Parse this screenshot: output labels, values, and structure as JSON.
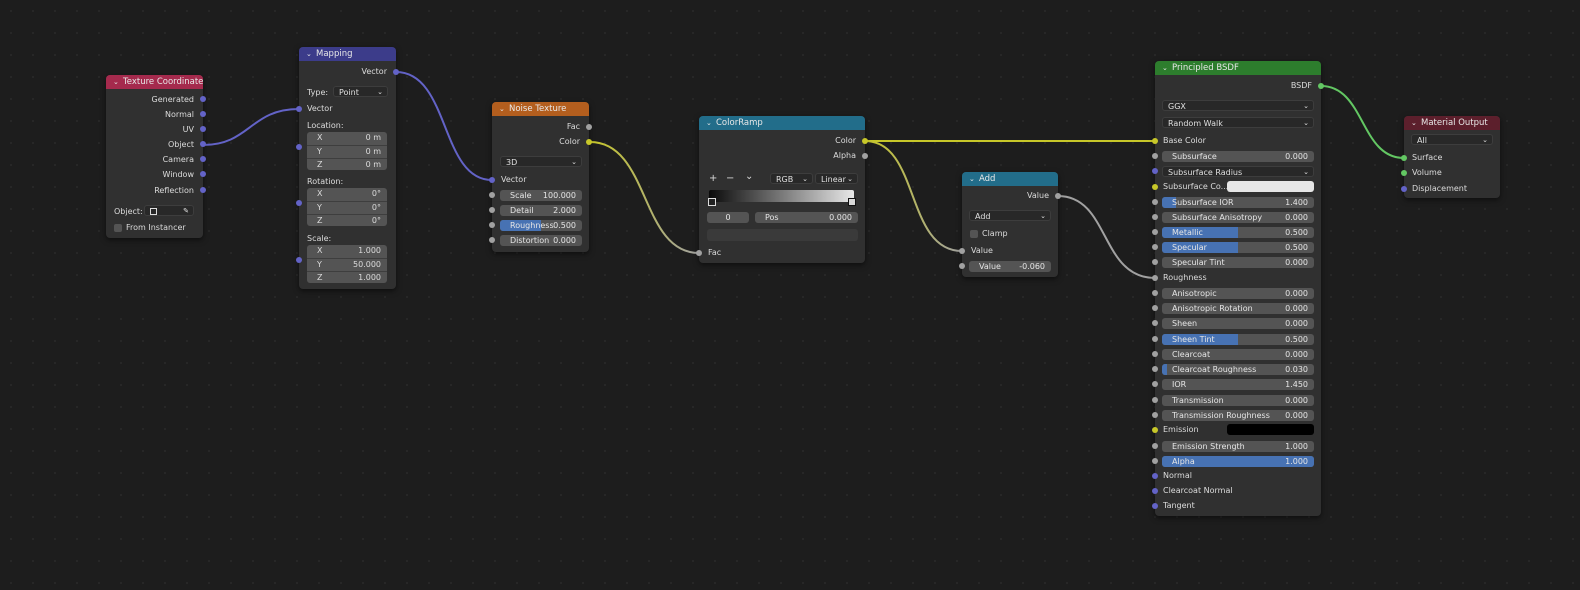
{
  "colors": {
    "vector_socket": "#6363c7",
    "color_socket": "#c7c729",
    "float_socket": "#a1a1a1",
    "shader_socket": "#63c763",
    "texture_coordinate_header": "#a52a4d",
    "mapping_header": "#3c3c8a",
    "noise_texture_header": "#b35e1e",
    "colorramp_header": "#226d8a",
    "add_header": "#226d8a",
    "principled_header": "#2d7d2d",
    "material_output_header": "#5c1f2c",
    "slider_fill": "#4772b3"
  },
  "nodes": {
    "texture_coordinate": {
      "title": "Texture Coordinate",
      "outputs": [
        "Generated",
        "Normal",
        "UV",
        "Object",
        "Camera",
        "Window",
        "Reflection"
      ],
      "object_label": "Object:",
      "from_instancer": "From Instancer",
      "icons": [
        "object-icon",
        "eyedropper-icon"
      ]
    },
    "mapping": {
      "title": "Mapping",
      "output": "Vector",
      "type_label": "Type:",
      "type_value": "Point",
      "input_vector": "Vector",
      "location_label": "Location:",
      "location": [
        {
          "axis": "X",
          "value": "0 m"
        },
        {
          "axis": "Y",
          "value": "0 m"
        },
        {
          "axis": "Z",
          "value": "0 m"
        }
      ],
      "rotation_label": "Rotation:",
      "rotation": [
        {
          "axis": "X",
          "value": "0°"
        },
        {
          "axis": "Y",
          "value": "0°"
        },
        {
          "axis": "Z",
          "value": "0°"
        }
      ],
      "scale_label": "Scale:",
      "scale": [
        {
          "axis": "X",
          "value": "1.000"
        },
        {
          "axis": "Y",
          "value": "50.000"
        },
        {
          "axis": "Z",
          "value": "1.000"
        }
      ]
    },
    "noise_texture": {
      "title": "Noise Texture",
      "outputs": [
        "Fac",
        "Color"
      ],
      "dimensions": "3D",
      "input_vector": "Vector",
      "fields": [
        {
          "label": "Scale",
          "value": "100.000",
          "fill": 0
        },
        {
          "label": "Detail",
          "value": "2.000",
          "fill": 0
        },
        {
          "label": "Roughness",
          "value": "0.500",
          "fill": 0.5
        },
        {
          "label": "Distortion",
          "value": "0.000",
          "fill": 0
        }
      ]
    },
    "colorramp": {
      "title": "ColorRamp",
      "outputs": [
        "Color",
        "Alpha"
      ],
      "add": "+",
      "remove": "−",
      "menu": "⌄",
      "color_mode": "RGB",
      "interpolation": "Linear",
      "index": "0",
      "pos_label": "Pos",
      "pos_value": "0.000",
      "input": "Fac"
    },
    "add": {
      "title": "Add",
      "output": "Value",
      "operation": "Add",
      "clamp": "Clamp",
      "input_value": "Value",
      "value_label": "Value",
      "value": "-0.060"
    },
    "principled_bsdf": {
      "title": "Principled BSDF",
      "output": "BSDF",
      "distribution": "GGX",
      "subsurface_method": "Random Walk",
      "base_color": "Base Color",
      "subsurface_radius": "Subsurface Radius",
      "subsurface_color": "Subsurface Co...",
      "emission": "Emission",
      "sliders": [
        {
          "label": "Subsurface",
          "value": "0.000",
          "fill": 0
        },
        {
          "label": "Subsurface IOR",
          "value": "1.400",
          "fill": 0.09
        },
        {
          "label": "Subsurface Anisotropy",
          "value": "0.000",
          "fill": 0
        },
        {
          "label": "Metallic",
          "value": "0.500",
          "fill": 0.5
        },
        {
          "label": "Specular",
          "value": "0.500",
          "fill": 0.5
        },
        {
          "label": "Specular Tint",
          "value": "0.000",
          "fill": 0
        }
      ],
      "roughness": "Roughness",
      "sliders2": [
        {
          "label": "Anisotropic",
          "value": "0.000",
          "fill": 0
        },
        {
          "label": "Anisotropic Rotation",
          "value": "0.000",
          "fill": 0
        },
        {
          "label": "Sheen",
          "value": "0.000",
          "fill": 0
        },
        {
          "label": "Sheen Tint",
          "value": "0.500",
          "fill": 0.5
        },
        {
          "label": "Clearcoat",
          "value": "0.000",
          "fill": 0
        },
        {
          "label": "Clearcoat Roughness",
          "value": "0.030",
          "fill": 0.03
        },
        {
          "label": "IOR",
          "value": "1.450",
          "fill": 0
        },
        {
          "label": "Transmission",
          "value": "0.000",
          "fill": 0
        },
        {
          "label": "Transmission Roughness",
          "value": "0.000",
          "fill": 0
        }
      ],
      "emission_strength": {
        "label": "Emission Strength",
        "value": "1.000",
        "fill": 0
      },
      "alpha": {
        "label": "Alpha",
        "value": "1.000",
        "fill": 1
      },
      "normal": "Normal",
      "clearcoat_normal": "Clearcoat Normal",
      "tangent": "Tangent"
    },
    "material_output": {
      "title": "Material Output",
      "target": "All",
      "inputs": [
        "Surface",
        "Volume",
        "Displacement"
      ]
    }
  }
}
